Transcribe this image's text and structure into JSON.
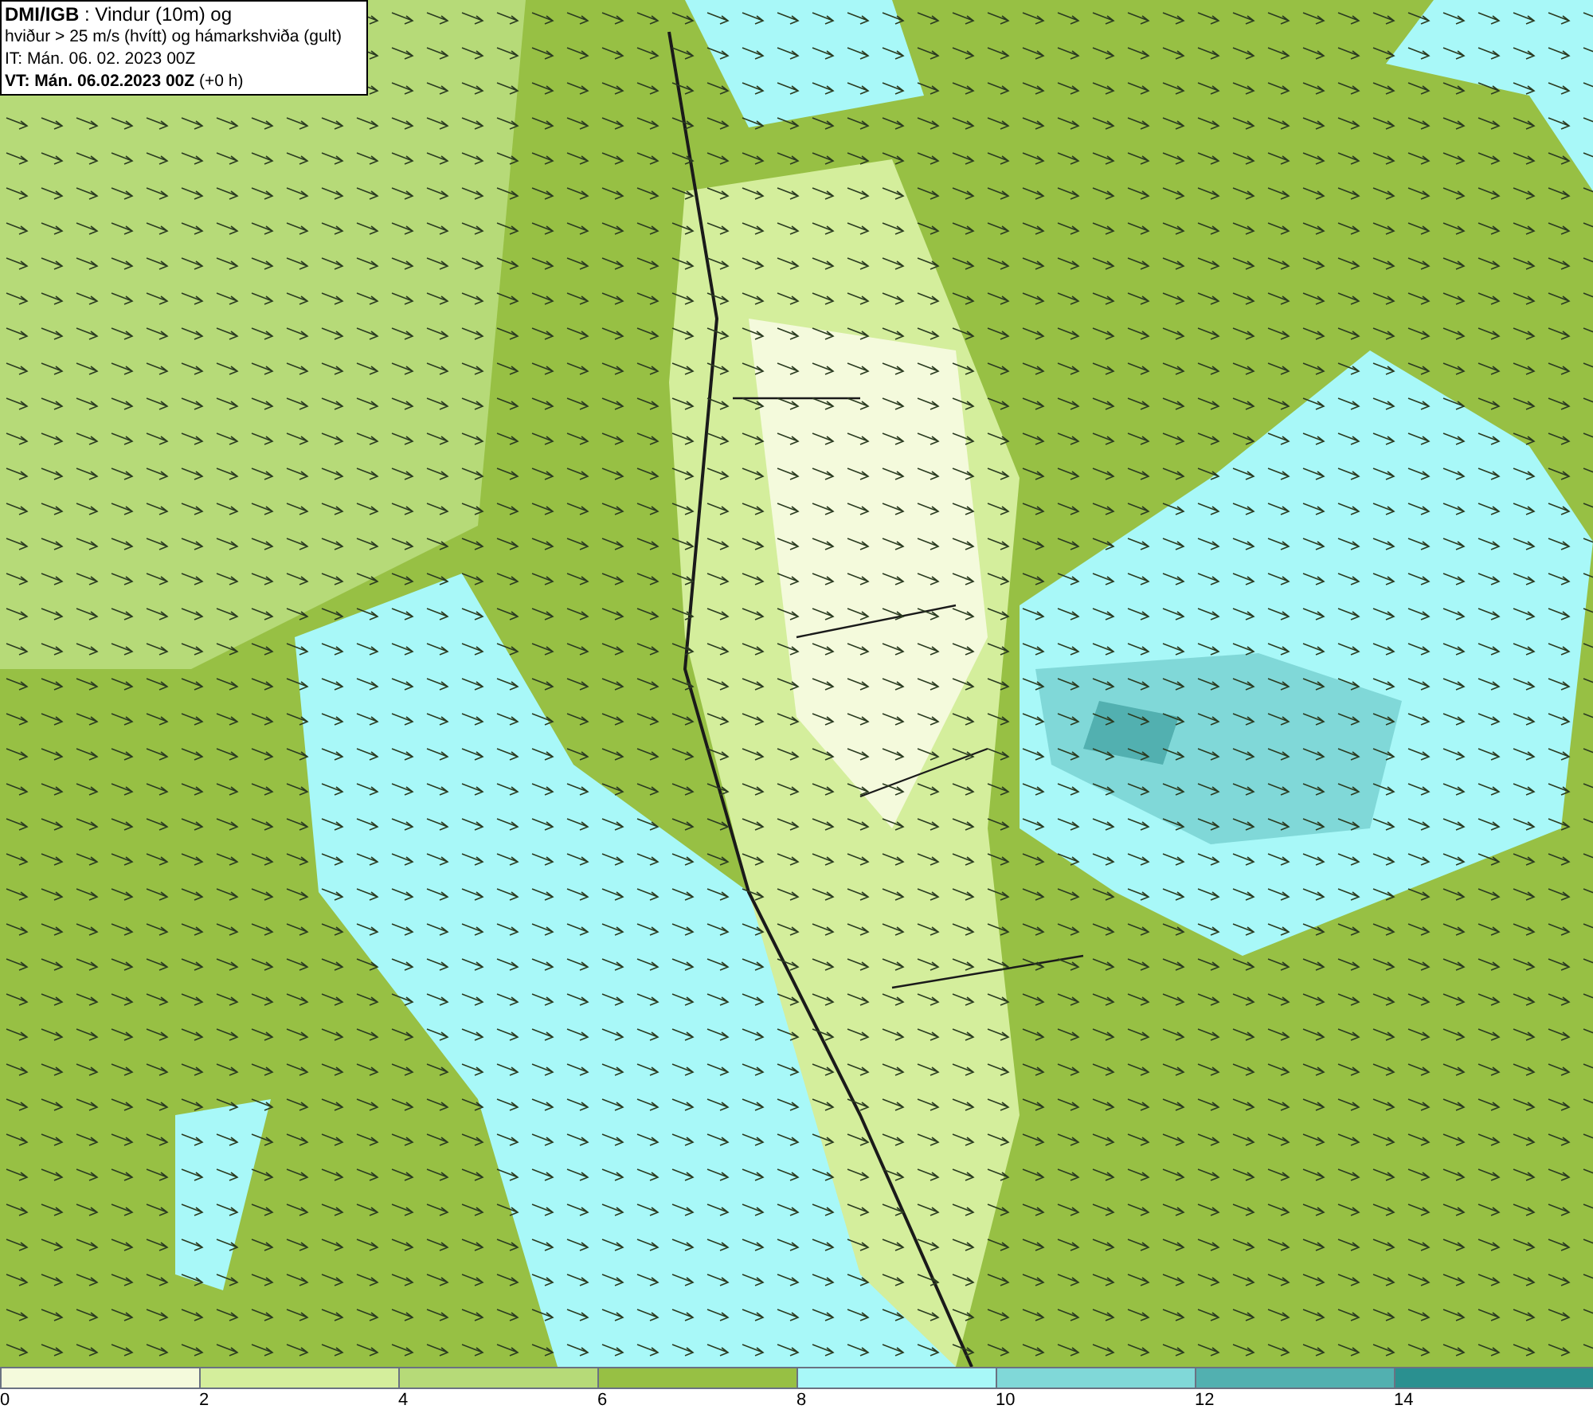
{
  "title_box": {
    "lines": [
      "**DMI/IGB** : Vindur (10m) og",
      "hviður > 25 m/s (hvítt) og hámarkshviða (gult)",
      "IT: Mán. 06. 02. 2023 00Z",
      "**VT: Mán. 06.02.2023 00Z** (+0 h)"
    ]
  },
  "legend": [
    {
      "label": "0",
      "color": "#f4fadc"
    },
    {
      "label": "2",
      "color": "#d4ee9c"
    },
    {
      "label": "4",
      "color": "#b6da78"
    },
    {
      "label": "6",
      "color": "#97c044"
    },
    {
      "label": "8",
      "color": "#a8f8f8"
    },
    {
      "label": "10",
      "color": "#80d8d8"
    },
    {
      "label": "12",
      "color": "#52b0b0"
    },
    {
      "label": "14",
      "color": "#2a9090"
    }
  ]
}
